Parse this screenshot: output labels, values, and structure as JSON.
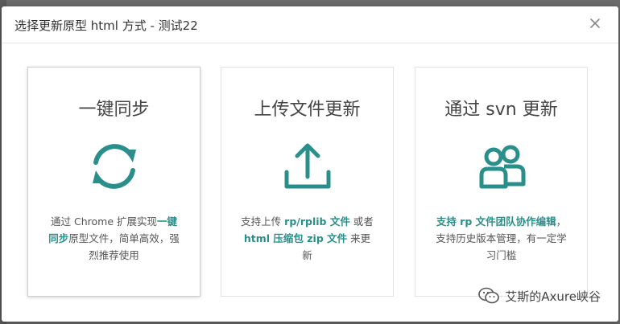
{
  "modal": {
    "title": "选择更新原型 html 方式 - 测试22"
  },
  "cards": [
    {
      "title": "一键同步",
      "icon": "sync-icon",
      "desc_prefix": "通过 Chrome 扩展实现",
      "desc_highlight": "一键同步",
      "desc_suffix": "原型文件，简单高效，强烈推荐使用"
    },
    {
      "title": "上传文件更新",
      "icon": "upload-icon",
      "desc_1": "支持上传 ",
      "desc_hl_1": "rp/rplib 文件",
      "desc_2": " 或者 ",
      "desc_hl_2": "html 压缩包 zip 文件",
      "desc_3": " 来更新"
    },
    {
      "title": "通过 svn 更新",
      "icon": "users-icon",
      "desc_highlight": "支持 rp 文件团队协作编辑",
      "desc_suffix": "，支持历史版本管理，有一定学习门槛"
    }
  ],
  "watermark": {
    "text": "艾斯的Axure峡谷",
    "icon": "wechat-icon"
  },
  "colors": {
    "accent": "#2a8f8a"
  }
}
